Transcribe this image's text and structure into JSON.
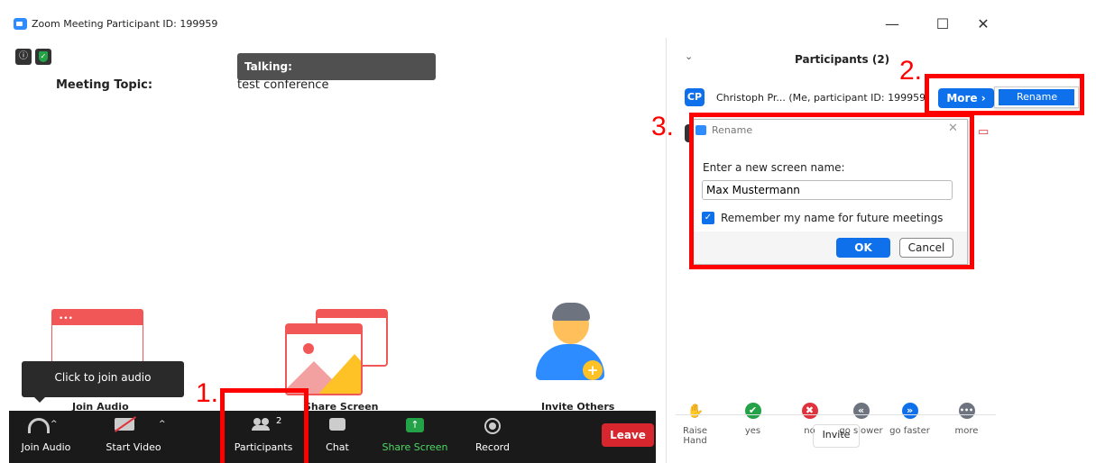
{
  "window": {
    "title": "Zoom Meeting Participant ID: 199959",
    "minimize": "—",
    "maximize": "☐",
    "close": "✕"
  },
  "meeting": {
    "topic_label": "Meeting Topic:",
    "topic_value": "test conference",
    "talking_label": "Talking:"
  },
  "tiles": {
    "join_audio": "Join Audio",
    "share_screen": "Share Screen",
    "invite_others": "Invite Others"
  },
  "tooltip": "Click to join audio",
  "toolbar": {
    "join_audio": "Join Audio",
    "start_video": "Start Video",
    "participants": "Participants",
    "participants_count": "2",
    "chat": "Chat",
    "share_screen": "Share Screen",
    "record": "Record",
    "leave": "Leave"
  },
  "participants_panel": {
    "header": "Participants (2)",
    "self_initials": "CP",
    "self_name": "Christoph Pr... (Me, participant ID: 199959)",
    "more_button": "More ›",
    "rename_menu_item": "Rename",
    "invite": "Invite",
    "reactions": [
      {
        "label": "Raise Hand",
        "icon": "hand-icon",
        "color": "#0e71eb",
        "glyph": "✋"
      },
      {
        "label": "yes",
        "icon": "check-icon",
        "color": "#23a247",
        "glyph": "✔"
      },
      {
        "label": "no",
        "icon": "x-icon",
        "color": "#e0323c",
        "glyph": "✖"
      },
      {
        "label": "go slower",
        "icon": "rewind-icon",
        "color": "#6e7380",
        "glyph": "«"
      },
      {
        "label": "go faster",
        "icon": "fast-forward-icon",
        "color": "#0e71eb",
        "glyph": "»"
      },
      {
        "label": "more",
        "icon": "ellipsis-icon",
        "color": "#6e7380",
        "glyph": "•••"
      }
    ]
  },
  "rename_dialog": {
    "title": "Rename",
    "prompt": "Enter a new screen name:",
    "name_value": "Max Mustermann",
    "remember_label": "Remember my name for future meetings",
    "remember_checked": true,
    "ok": "OK",
    "cancel": "Cancel"
  },
  "annotations": {
    "step1": "1.",
    "step2": "2.",
    "step3": "3."
  },
  "colors": {
    "accent": "#0e71eb",
    "leave": "#d7262d",
    "annotation": "#ff0000",
    "toolbar": "#1a1a1a",
    "share_green": "#23a247"
  }
}
